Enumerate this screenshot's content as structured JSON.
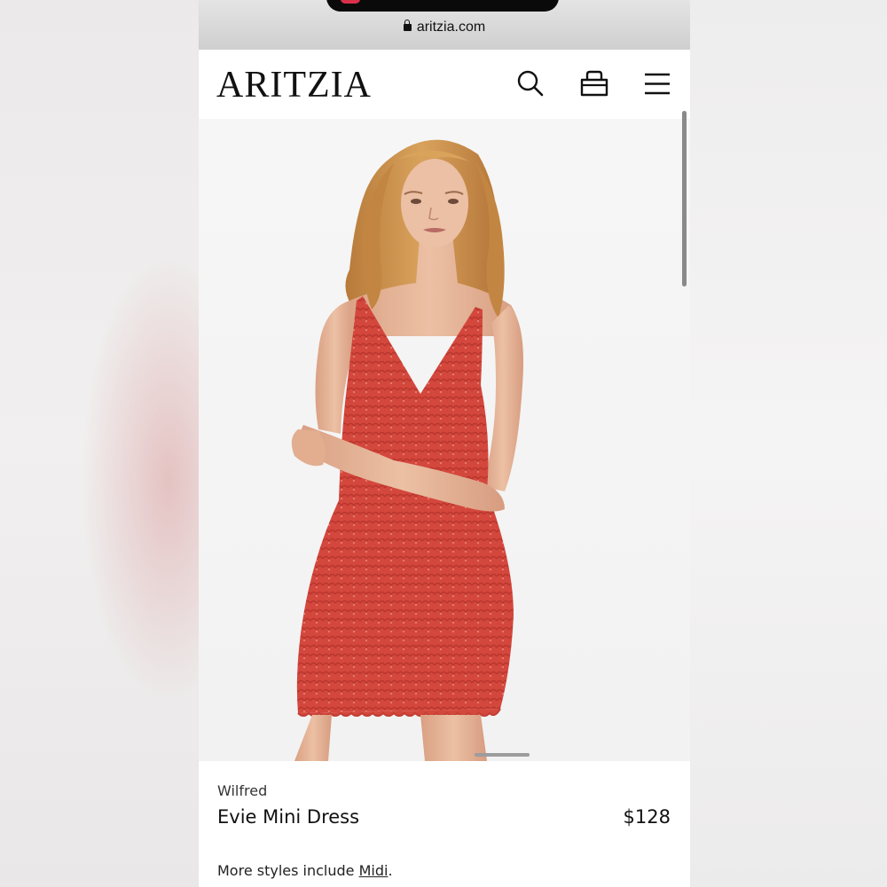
{
  "browser": {
    "url": "aritzia.com"
  },
  "header": {
    "logo": "ARITZIA",
    "icons": [
      "search-icon",
      "shopping-bag-icon",
      "menu-icon"
    ]
  },
  "product": {
    "brand": "Wilfred",
    "name": "Evie Mini Dress",
    "price": "$128",
    "more_styles_prefix": "More styles include ",
    "more_styles_link": "Midi",
    "more_styles_suffix": "."
  },
  "colors": {
    "dress": "#d34a40",
    "hair": "#c98a45",
    "skin": "#e6b497",
    "background": "#f4f4f4"
  }
}
